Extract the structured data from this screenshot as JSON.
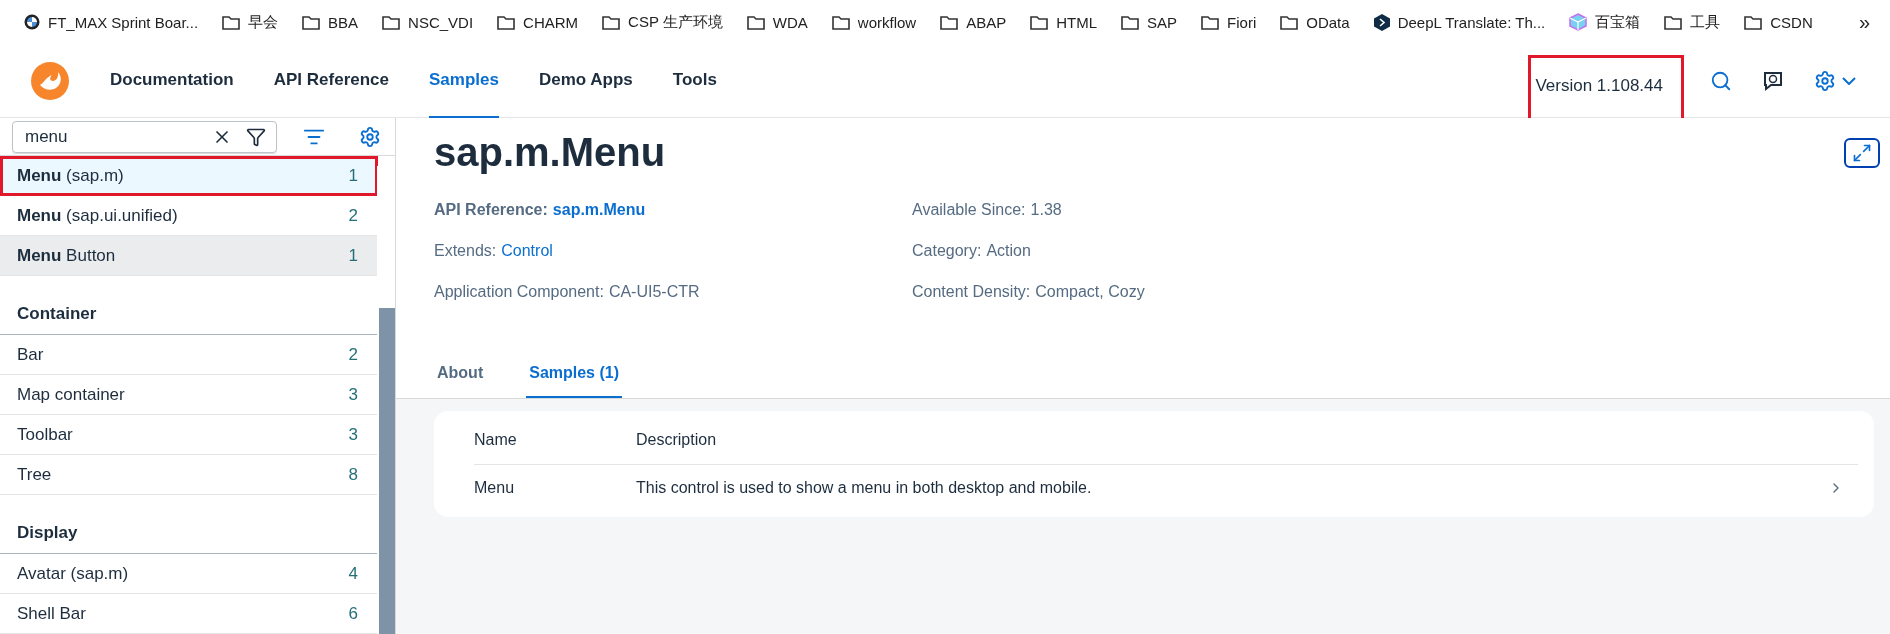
{
  "bookmarks": [
    {
      "kind": "roundel",
      "label": "FT_MAX Sprint Boar..."
    },
    {
      "kind": "folder",
      "label": "早会"
    },
    {
      "kind": "folder",
      "label": "BBA"
    },
    {
      "kind": "folder",
      "label": "NSC_VDI"
    },
    {
      "kind": "folder",
      "label": "CHARM"
    },
    {
      "kind": "folder",
      "label": "CSP 生产环境"
    },
    {
      "kind": "folder",
      "label": "WDA"
    },
    {
      "kind": "folder",
      "label": "workflow"
    },
    {
      "kind": "folder",
      "label": "ABAP"
    },
    {
      "kind": "folder",
      "label": "HTML"
    },
    {
      "kind": "folder",
      "label": "SAP"
    },
    {
      "kind": "folder",
      "label": "Fiori"
    },
    {
      "kind": "folder",
      "label": "OData"
    },
    {
      "kind": "hexagon",
      "label": "DeepL Translate: Th..."
    },
    {
      "kind": "cube",
      "label": "百宝箱"
    },
    {
      "kind": "folder",
      "label": "工具"
    },
    {
      "kind": "folder",
      "label": "CSDN"
    }
  ],
  "bookmarks_more": "»",
  "nav": [
    {
      "label": "Documentation",
      "selected": false
    },
    {
      "label": "API Reference",
      "selected": false
    },
    {
      "label": "Samples",
      "selected": true
    },
    {
      "label": "Demo Apps",
      "selected": false
    },
    {
      "label": "Tools",
      "selected": false
    }
  ],
  "version": {
    "text": "Version 1.108.44",
    "highlighted": true
  },
  "search": {
    "value": "menu"
  },
  "sidebar": {
    "groups": [
      {
        "items": [
          {
            "label": "**Menu** (sap.m)",
            "count": "1",
            "selected": true,
            "hovered": false,
            "highlighted": true
          },
          {
            "label": "**Menu** (sap.ui.unified)",
            "count": "2",
            "selected": false,
            "hovered": false,
            "highlighted": false
          },
          {
            "label": "**Menu** Button",
            "count": "1",
            "selected": false,
            "hovered": true,
            "highlighted": false
          }
        ]
      },
      {
        "title": "Container",
        "items": [
          {
            "label": "Bar",
            "count": "2",
            "selected": false,
            "hovered": false,
            "highlighted": false
          },
          {
            "label": "Map container",
            "count": "3",
            "selected": false,
            "hovered": false,
            "highlighted": false
          },
          {
            "label": "Toolbar",
            "count": "3",
            "selected": false,
            "hovered": false,
            "highlighted": false
          },
          {
            "label": "Tree",
            "count": "8",
            "selected": false,
            "hovered": false,
            "highlighted": false
          }
        ]
      },
      {
        "title": "Display",
        "items": [
          {
            "label": "Avatar (sap.m)",
            "count": "4",
            "selected": false,
            "hovered": false,
            "highlighted": false
          },
          {
            "label": "Shell Bar",
            "count": "6",
            "selected": false,
            "hovered": false,
            "highlighted": false
          }
        ]
      }
    ]
  },
  "page": {
    "title": "sap.m.Menu",
    "info_left": [
      {
        "label": "API Reference:",
        "value": "sap.m.Menu",
        "kind": "boldlink"
      },
      {
        "label": "Extends:",
        "value": "Control",
        "kind": "link"
      },
      {
        "label": "Application Component:",
        "value": "CA-UI5-CTR",
        "kind": "plain"
      }
    ],
    "info_right": [
      {
        "label": "Available Since:",
        "value": "1.38",
        "kind": "plain"
      },
      {
        "label": "Category:",
        "value": "Action",
        "kind": "plain"
      },
      {
        "label": "Content Density:",
        "value": "Compact, Cozy",
        "kind": "plain"
      }
    ],
    "tabs": [
      {
        "label": "About",
        "selected": false
      },
      {
        "label": "Samples (1)",
        "selected": true
      }
    ],
    "table": {
      "columns": [
        "Name",
        "Description"
      ],
      "rows": [
        {
          "name": "Menu",
          "description": "This control is used to show a menu in both desktop and mobile."
        }
      ]
    }
  }
}
